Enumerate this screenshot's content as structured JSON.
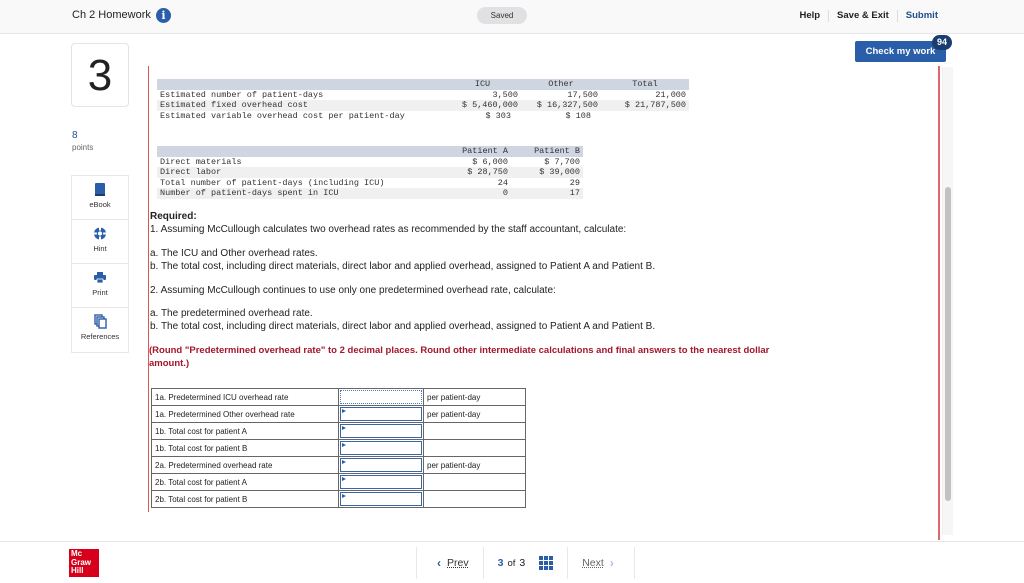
{
  "header": {
    "assignment_title": "Ch 2 Homework",
    "info_icon": "info-icon",
    "save_status": "Saved",
    "links": {
      "help": "Help",
      "save_exit": "Save & Exit",
      "submit": "Submit"
    },
    "check_my_work": "Check my work",
    "check_badge": "94"
  },
  "question": {
    "number": "3",
    "points_value": "8",
    "points_label": "points"
  },
  "tools": [
    {
      "label": "eBook",
      "icon": "book-icon"
    },
    {
      "label": "Hint",
      "icon": "lifebuoy-icon"
    },
    {
      "label": "Print",
      "icon": "printer-icon"
    },
    {
      "label": "References",
      "icon": "copy-icon"
    }
  ],
  "overhead_table": {
    "headers": [
      "",
      "ICU",
      "Other",
      "Total"
    ],
    "rows": [
      [
        "Estimated number of patient-days",
        "3,500",
        "17,500",
        "21,000"
      ],
      [
        "Estimated fixed overhead cost",
        "$ 5,460,000",
        "$ 16,327,500",
        "$ 21,787,500"
      ],
      [
        "Estimated variable overhead cost per patient-day",
        "$ 303",
        "$ 108",
        ""
      ]
    ]
  },
  "patient_table": {
    "headers": [
      "",
      "Patient A",
      "Patient B"
    ],
    "rows": [
      [
        "Direct materials",
        "$ 6,000",
        "$ 7,700"
      ],
      [
        "Direct labor",
        "$ 28,750",
        "$ 39,000"
      ],
      [
        "Total number of patient-days (including ICU)",
        "24",
        "29"
      ],
      [
        "Number of patient-days spent in ICU",
        "0",
        "17"
      ]
    ]
  },
  "required": {
    "title": "Required:",
    "q1": "1. Assuming McCullough calculates two overhead rates as recommended by the staff accountant, calculate:",
    "q1a": "a. The ICU and Other overhead rates.",
    "q1b": "b. The total cost, including direct materials, direct labor and applied overhead, assigned to Patient A and Patient B.",
    "q2": "2. Assuming McCullough continues to use only one predetermined overhead rate, calculate:",
    "q2a": "a. The predetermined overhead rate.",
    "q2b": "b. The total cost, including direct materials, direct labor and applied overhead, assigned to Patient A and Patient B.",
    "rounding_note": "(Round \"Predetermined overhead rate\" to 2 decimal places. Round other intermediate calculations and final answers to the nearest dollar amount.)"
  },
  "answers": [
    {
      "label": "1a. Predetermined ICU overhead rate",
      "value": "",
      "unit": "per patient-day"
    },
    {
      "label": "1a. Predetermined Other overhead rate",
      "value": "",
      "unit": "per patient-day"
    },
    {
      "label": "1b. Total cost for patient A",
      "value": "",
      "unit": ""
    },
    {
      "label": "1b. Total cost for patient B",
      "value": "",
      "unit": ""
    },
    {
      "label": "2a. Predetermined overhead rate",
      "value": "",
      "unit": "per patient-day"
    },
    {
      "label": "2b. Total cost for patient A",
      "value": "",
      "unit": ""
    },
    {
      "label": "2b. Total cost for patient B",
      "value": "",
      "unit": ""
    }
  ],
  "footer": {
    "logo": [
      "Mc",
      "Graw",
      "Hill"
    ],
    "prev": "Prev",
    "current_page": "3",
    "of_label": "of",
    "total_pages": "3",
    "next": "Next"
  },
  "colors": {
    "brand_blue": "#2a5ea8",
    "badge_navy": "#1b3c6e",
    "note_red": "#a3162c",
    "logo_red": "#d6001c"
  }
}
